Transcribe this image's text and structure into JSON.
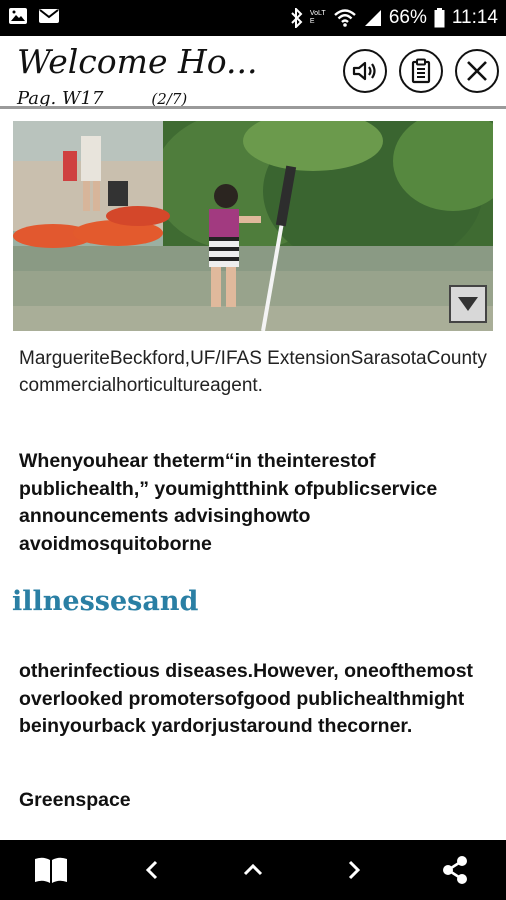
{
  "status_bar": {
    "battery": "66%",
    "time": "11:14",
    "volte": "VoLTE"
  },
  "header": {
    "title": "Welcome Ho...",
    "subtitle": "Pag. W17",
    "page_indicator": "(2/7)"
  },
  "article": {
    "caption": "MargueriteBeckford,UF/IFAS ExtensionSarasotaCounty commercialhorticultureagent.",
    "paragraph1": "Whenyouhear theterm“in theinterestof publichealth,” youmightthink ofpublicservice announcements advisinghowto avoidmosquitoborne",
    "heading": "illnessesand",
    "paragraph2": "otherinfectious diseases.However, oneofthemost overlooked promotersofgood publichealthmight beinyourback yardorjustaround thecorner.",
    "section_title": "Greenspace"
  },
  "icons": {
    "header_buttons": [
      "speaker-icon",
      "clipboard-icon",
      "close-icon"
    ],
    "bottom_nav": [
      "book-icon",
      "chevron-left-icon",
      "chevron-up-icon",
      "chevron-right-icon",
      "share-icon"
    ]
  }
}
